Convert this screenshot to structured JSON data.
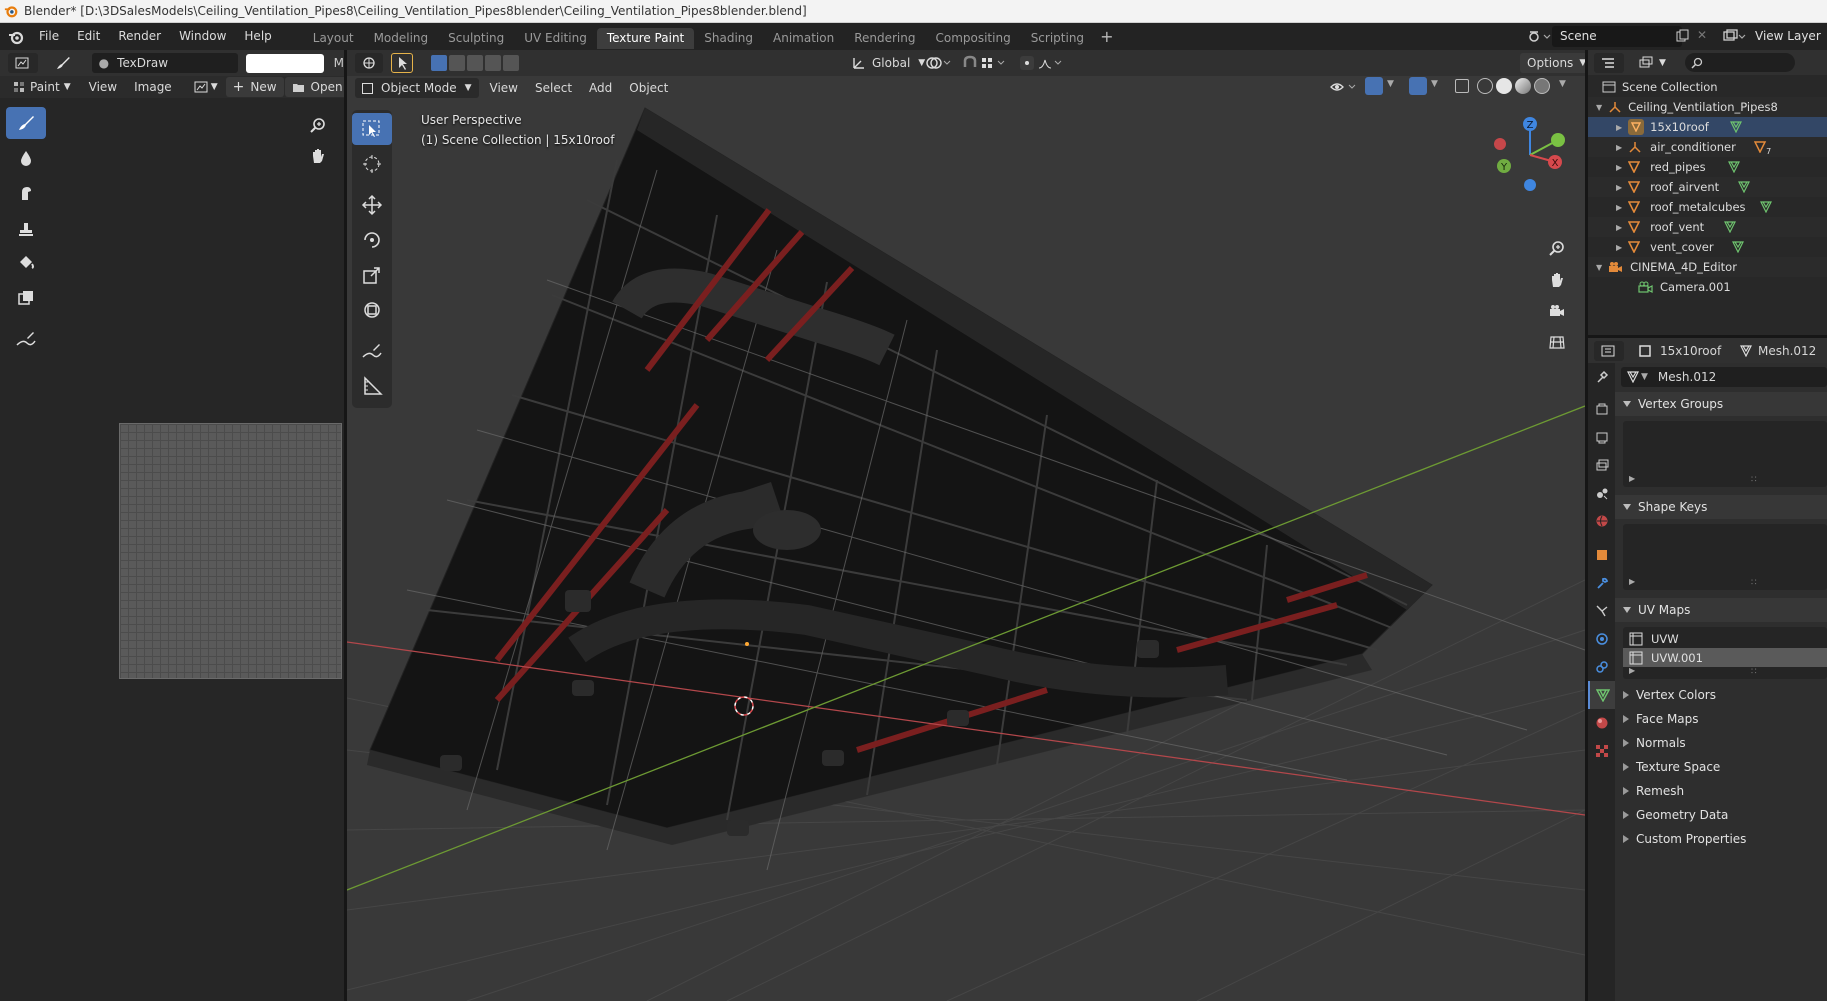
{
  "window": {
    "title": "Blender* [D:\\3DSalesModels\\Ceiling_Ventilation_Pipes8\\Ceiling_Ventilation_Pipes8blender\\Ceiling_Ventilation_Pipes8blender.blend]"
  },
  "menu": [
    "File",
    "Edit",
    "Render",
    "Window",
    "Help"
  ],
  "workspaces": [
    "Layout",
    "Modeling",
    "Sculpting",
    "UV Editing",
    "Texture Paint",
    "Shading",
    "Animation",
    "Rendering",
    "Compositing",
    "Scripting"
  ],
  "active_workspace": "Texture Paint",
  "scene": {
    "scene_name": "Scene",
    "view_layer": "View Layer"
  },
  "image_editor": {
    "brush_name": "TexDraw",
    "truncated_label": "M",
    "menus": {
      "paint": "Paint",
      "view": "View",
      "image": "Image"
    },
    "new_label": "New",
    "open_label": "Open"
  },
  "viewport": {
    "mode": "Object Mode",
    "menus": [
      "View",
      "Select",
      "Add",
      "Object"
    ],
    "orientation": "Global",
    "options_label": "Options",
    "info_line1": "User Perspective",
    "info_line2": "(1) Scene Collection | 15x10roof",
    "gizmo_axes": {
      "x": "X",
      "y": "Y",
      "z": "Z"
    }
  },
  "outliner": {
    "root": "Scene Collection",
    "collection": "Ceiling_Ventilation_Pipes8",
    "objects": [
      {
        "name": "15x10roof",
        "modifier_badge": ""
      },
      {
        "name": "air_conditioner",
        "modifier_badge": "7"
      },
      {
        "name": "red_pipes",
        "modifier_badge": ""
      },
      {
        "name": "roof_airvent",
        "modifier_badge": ""
      },
      {
        "name": "roof_metalcubes",
        "modifier_badge": ""
      },
      {
        "name": "roof_vent",
        "modifier_badge": ""
      },
      {
        "name": "vent_cover",
        "modifier_badge": ""
      }
    ],
    "camera_collection": "CINEMA_4D_Editor",
    "camera": "Camera.001"
  },
  "properties": {
    "object_name": "15x10roof",
    "mesh_name": "Mesh.012",
    "datablock": "Mesh.012",
    "panels": {
      "vertex_groups": "Vertex Groups",
      "shape_keys": "Shape Keys",
      "uv_maps": "UV Maps"
    },
    "uv_maps": [
      "UVW",
      "UVW.001"
    ],
    "active_uv": "UVW.001",
    "collapsed_panels": [
      "Vertex Colors",
      "Face Maps",
      "Normals",
      "Texture Space",
      "Remesh",
      "Geometry Data",
      "Custom Properties"
    ]
  },
  "colors": {
    "accent": "#4772b3",
    "x_axis": "#d6494d",
    "y_axis": "#7ac143",
    "z_axis": "#3f86e0",
    "object_orange": "#e38a3a",
    "mesh_green": "#6fc46f"
  }
}
